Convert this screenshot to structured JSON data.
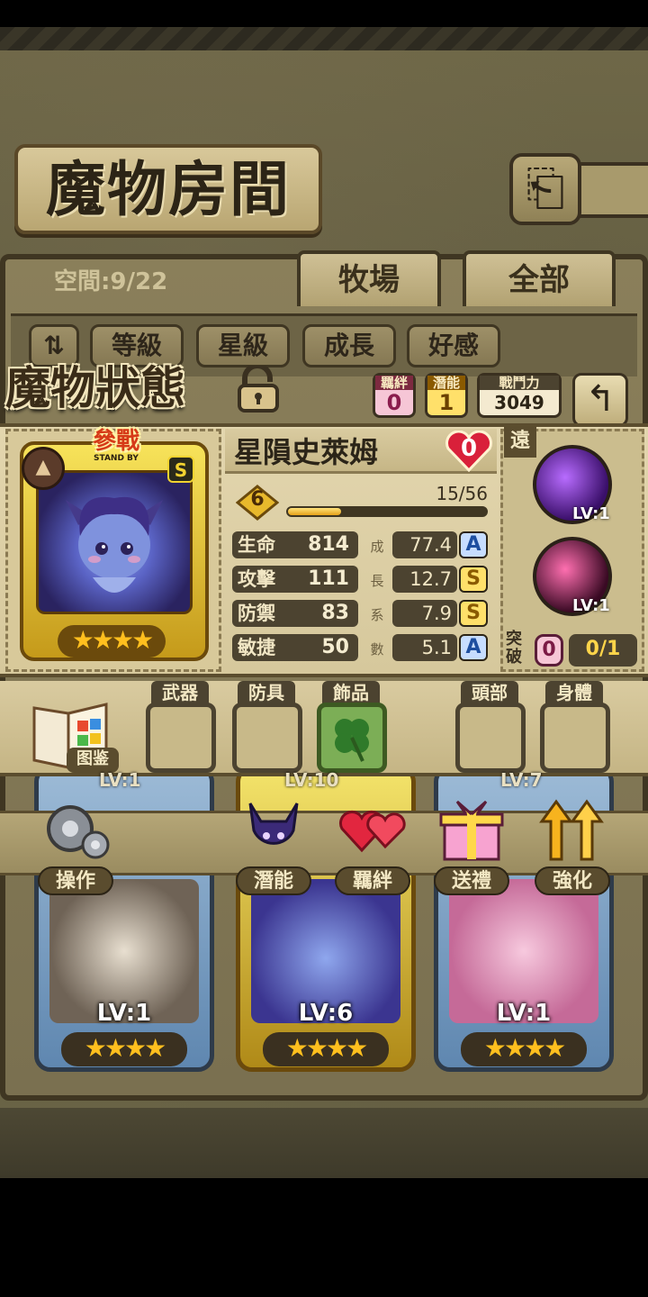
{
  "header": {
    "title": "魔物房間",
    "space": "空間:9/22"
  },
  "tabs": [
    "牧場",
    "全部"
  ],
  "sort_buttons": [
    "等級",
    "星級",
    "成長",
    "好感"
  ],
  "status": {
    "title": "魔物狀態",
    "bond_label": "羈絆",
    "bond_value": "0",
    "potential_label": "潛能",
    "potential_value": "1",
    "power_label": "戰鬥力",
    "power_value": "3049"
  },
  "monster": {
    "name": "星隕史萊姆",
    "affection": "0",
    "standby": "參戰",
    "standby_en": "STAND BY",
    "rank": "S",
    "stars": "★★★★",
    "level": "6",
    "exp_text": "15/56",
    "exp_fraction": 0.268,
    "stats": [
      {
        "label": "生命",
        "value": "814",
        "growth_char": "成",
        "growth": "77.4",
        "grade": "A"
      },
      {
        "label": "攻擊",
        "value": "111",
        "growth_char": "長",
        "growth": "12.7",
        "grade": "S"
      },
      {
        "label": "防禦",
        "value": "83",
        "growth_char": "系",
        "growth": "7.9",
        "grade": "S"
      },
      {
        "label": "敏捷",
        "value": "50",
        "growth_char": "數",
        "growth": "5.1",
        "grade": "A"
      }
    ],
    "range": "遠",
    "skills": [
      {
        "lv": "LV:1"
      },
      {
        "lv": "LV:1"
      }
    ],
    "breakout_label": "突破",
    "breakout_pill": "0",
    "breakout_value": "0/1"
  },
  "equipment": {
    "book_label": "图鉴",
    "slots": [
      "武器",
      "防具",
      "飾品",
      "頭部",
      "身體"
    ]
  },
  "actions": [
    "操作",
    "潛能",
    "羈絆",
    "送禮",
    "強化"
  ],
  "roster": [
    {
      "lv": "LV:1",
      "stars": "★★★★",
      "color": "#5f87b0"
    },
    {
      "lv": "LV:6",
      "stars": "★★★★",
      "color": "#d2bf3a"
    },
    {
      "lv": "LV:1",
      "stars": "★★★★",
      "color": "#5f87b0"
    }
  ],
  "roster_top_levels": [
    "LV:1",
    "LV:10",
    "LV:7"
  ]
}
